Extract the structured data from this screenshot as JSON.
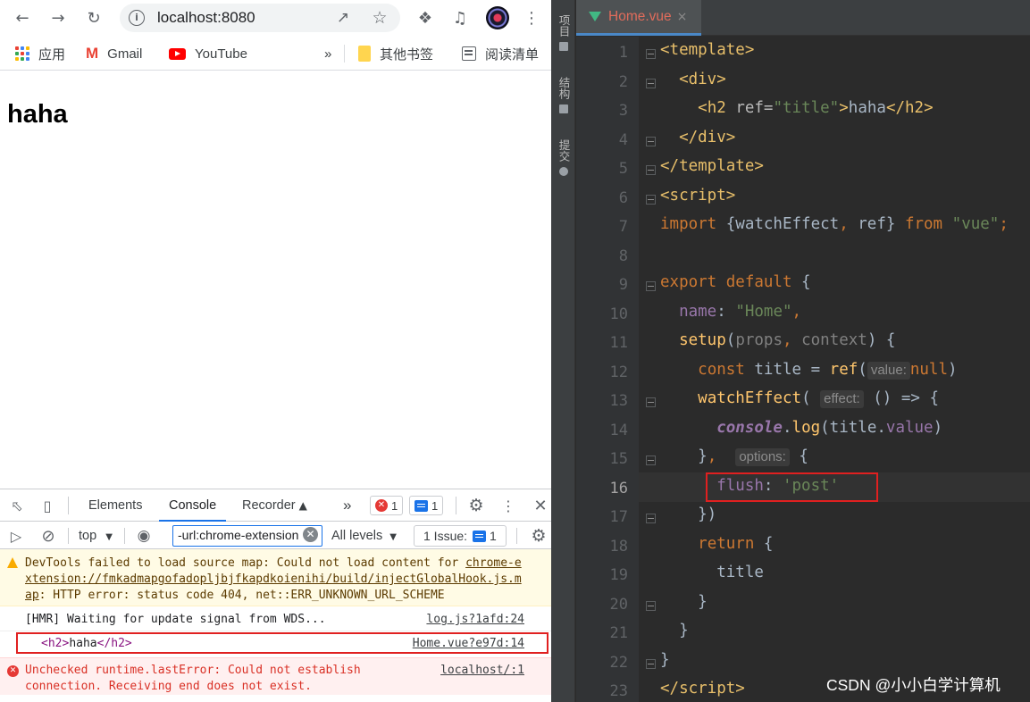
{
  "browser": {
    "url": "localhost:8080",
    "bookmarks": [
      "应用",
      "Gmail",
      "YouTube",
      "»",
      "其他书签",
      "阅读清单"
    ]
  },
  "page": {
    "heading": "haha"
  },
  "devtools": {
    "tabs": [
      "Elements",
      "Console",
      "Recorder"
    ],
    "more": "»",
    "error_count": "1",
    "message_count": "1",
    "context": "top",
    "filter_value": "-url:chrome-extension",
    "levels": "All levels",
    "issues_label": "1 Issue:",
    "issues_count": "1",
    "messages": [
      {
        "type": "warning",
        "text": "DevTools failed to load source map: Could not load content for ",
        "link": "chrome-extension://fmkadmapgofadopljbjfkapdkoienihi/build/injectGlobalHook.js.map",
        "rest": ": HTTP error: status code 404, net::ERR_UNKNOWN_URL_SCHEME"
      },
      {
        "type": "log",
        "text": "[HMR] Waiting for update signal from WDS...",
        "source": "log.js?1afd:24"
      },
      {
        "type": "log",
        "open": "<h2>",
        "text": "haha",
        "close": "</h2>",
        "source": "Home.vue?e97d:14"
      },
      {
        "type": "error",
        "text1": "Unchecked runtime.lastError: Could not establish",
        "text2": "connection. Receiving end does not exist.",
        "source": "localhost/:1"
      }
    ]
  },
  "ide": {
    "side_tabs": [
      "项目",
      "结构",
      "提交"
    ],
    "file_tab": "Home.vue",
    "line_numbers": [
      "1",
      "2",
      "3",
      "4",
      "5",
      "6",
      "7",
      "8",
      "9",
      "10",
      "11",
      "12",
      "13",
      "14",
      "15",
      "16",
      "17",
      "18",
      "19",
      "20",
      "21",
      "22",
      "23"
    ],
    "hints": {
      "value": "value:",
      "effect": "effect:",
      "options": "options:"
    }
  },
  "watermark": "CSDN @小小白学计算机",
  "colors": {
    "highlight_box": "#e02020",
    "accent": "#1a73e8",
    "ide_bg": "#2b2b2b"
  }
}
